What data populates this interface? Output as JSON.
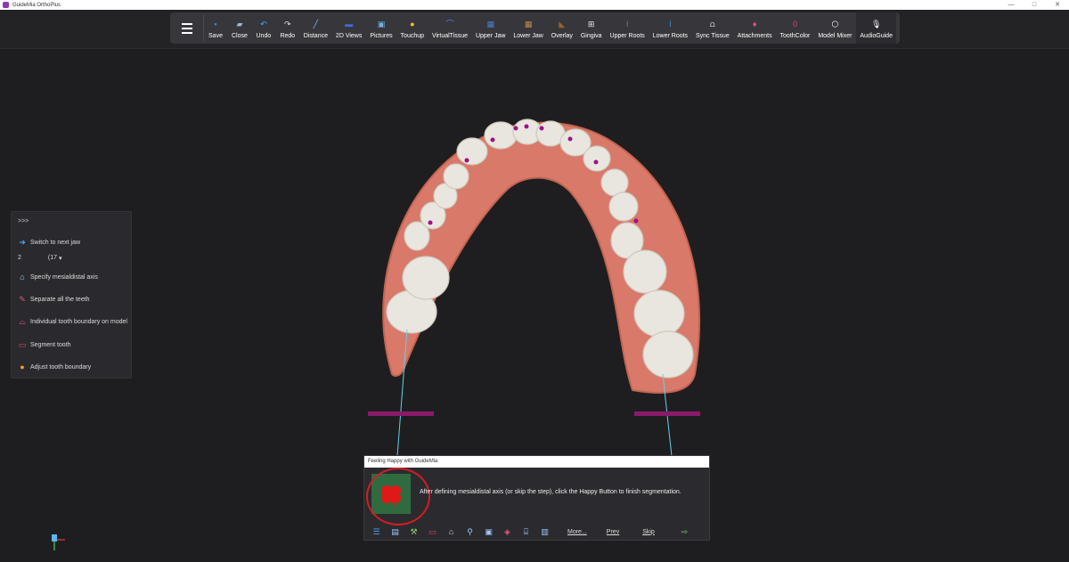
{
  "window": {
    "title": "GuideMia OrthoPlus",
    "controls": [
      "—",
      "□",
      "✕"
    ]
  },
  "toolbar": {
    "menu_icon": "hamburger-icon",
    "tools": [
      {
        "id": "save",
        "label": "Save",
        "icon": "floppy-icon",
        "color": "#3b8fd9"
      },
      {
        "id": "close",
        "label": "Close",
        "icon": "close-file-icon",
        "color": "#9fb7e0"
      },
      {
        "id": "undo",
        "label": "Undo",
        "icon": "undo-icon",
        "color": "#4aa3ff"
      },
      {
        "id": "redo",
        "label": "Redo",
        "icon": "redo-icon",
        "color": "#e0e0e0"
      },
      {
        "id": "distance",
        "label": "Distance",
        "icon": "ruler-icon",
        "color": "#7fb9ff"
      },
      {
        "id": "2dviews",
        "label": "2D Views",
        "icon": "monitor-icon",
        "color": "#3b6fd9"
      },
      {
        "id": "pictures",
        "label": "Pictures",
        "icon": "picture-icon",
        "color": "#6fb3e0"
      },
      {
        "id": "touchup",
        "label": "Touchup",
        "icon": "touchup-icon",
        "color": "#f2c230"
      },
      {
        "id": "virtualtissue",
        "label": "VirtualTissue",
        "icon": "tissue-arc-icon",
        "color": "#4a8fff"
      },
      {
        "id": "upperjaw",
        "label": "Upper Jaw",
        "icon": "upper-jaw-icon",
        "color": "#4c7fd0"
      },
      {
        "id": "lowerjaw",
        "label": "Lower Jaw",
        "icon": "lower-jaw-icon",
        "color": "#c08a4a"
      },
      {
        "id": "overlay",
        "label": "Overlay",
        "icon": "overlay-icon",
        "color": "#a0602e"
      },
      {
        "id": "gingiva",
        "label": "Gingiva",
        "icon": "gingiva-icon",
        "color": "#e8e8e8"
      },
      {
        "id": "upperroots",
        "label": "Upper Roots",
        "icon": "upper-roots-icon",
        "color": "#3b8fd9"
      },
      {
        "id": "lowerroots",
        "label": "Lower Roots",
        "icon": "lower-roots-icon",
        "color": "#3b8fd9"
      },
      {
        "id": "synctissue",
        "label": "Sync Tissue",
        "icon": "sync-tissue-icon",
        "color": "#eeeeee"
      },
      {
        "id": "attachments",
        "label": "Attachments",
        "icon": "attachment-tooth-icon",
        "color": "#e35a7a"
      },
      {
        "id": "toothcolor",
        "label": "ToothColor",
        "icon": "tooth-color-icon",
        "color": "#e04060"
      },
      {
        "id": "modelmixer",
        "label": "Model Mixer",
        "icon": "cube-icon",
        "color": "#ffffff"
      },
      {
        "id": "audioguide",
        "label": "AudioGuide",
        "icon": "mic-off-icon",
        "color": "#ffffff"
      }
    ]
  },
  "left_panel": {
    "expand": ">>>",
    "switch_label": "Switch to next jaw",
    "tooth_start": "2",
    "tooth_end": "(17",
    "items": [
      {
        "label": "Specify mesialdistal axis",
        "icon": "tooth-axis-icon"
      },
      {
        "label": "Separate all the teeth",
        "icon": "separate-teeth-icon"
      },
      {
        "label": "Individual tooth boundary on model",
        "icon": "tooth-boundary-icon"
      },
      {
        "label": "Segment tooth",
        "icon": "segment-tooth-icon"
      },
      {
        "label": "Adjust tooth boundary",
        "icon": "adjust-boundary-icon"
      }
    ]
  },
  "dialog": {
    "title": "Feeling Happy with GuideMia",
    "message": "After defining mesialdistal axis (or skip the step), click the Happy Button to finish segmentation.",
    "more_label": "More...",
    "prev_label": "Prev",
    "skip_label": "Skip"
  },
  "colors": {
    "accent_magenta": "#8c1a6a",
    "axis_cyan": "#5fd3e8",
    "marker_purple": "#a0108a",
    "gum": "#d9796a",
    "tooth": "#e9e6df",
    "happy_bg": "#2f6b3f",
    "highlight_ring": "#d41d25"
  }
}
